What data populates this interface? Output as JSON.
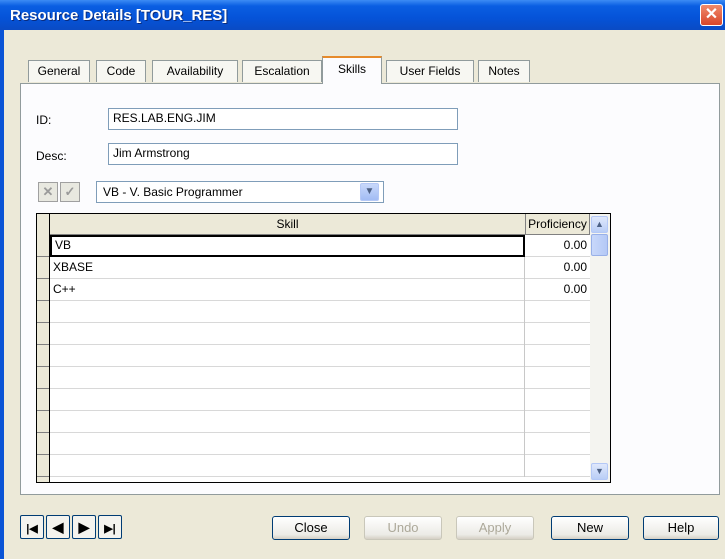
{
  "window": {
    "title": "Resource Details [TOUR_RES]",
    "close_glyph": "✕"
  },
  "tabs": [
    {
      "label": "General",
      "active": false
    },
    {
      "label": "Code",
      "active": false
    },
    {
      "label": "Availability",
      "active": false
    },
    {
      "label": "Escalation",
      "active": false
    },
    {
      "label": "Skills",
      "active": true
    },
    {
      "label": "User Fields",
      "active": false
    },
    {
      "label": "Notes",
      "active": false
    }
  ],
  "form": {
    "id_label": "ID:",
    "id_value": "RES.LAB.ENG.JIM",
    "desc_label": "Desc:",
    "desc_value": "Jim Armstrong"
  },
  "skill_toolbar": {
    "cancel_icon": "cross-icon",
    "cancel_glyph": "✕",
    "accept_icon": "checkmark-icon",
    "accept_glyph": "✓",
    "selected_skill": "VB - V. Basic Programmer",
    "dropdown_glyph": "▼"
  },
  "grid": {
    "columns": [
      "Skill",
      "Proficiency"
    ],
    "rows": [
      {
        "skill": "VB",
        "proficiency": "0.00"
      },
      {
        "skill": "XBASE",
        "proficiency": "0.00"
      },
      {
        "skill": "C++",
        "proficiency": "0.00"
      },
      {
        "skill": "",
        "proficiency": ""
      },
      {
        "skill": "",
        "proficiency": ""
      },
      {
        "skill": "",
        "proficiency": ""
      },
      {
        "skill": "",
        "proficiency": ""
      },
      {
        "skill": "",
        "proficiency": ""
      },
      {
        "skill": "",
        "proficiency": ""
      },
      {
        "skill": "",
        "proficiency": ""
      },
      {
        "skill": "",
        "proficiency": ""
      }
    ],
    "scroll_up_glyph": "▲",
    "scroll_down_glyph": "▼"
  },
  "navigation": {
    "first_glyph": "|◀",
    "prev_glyph": "◀",
    "next_glyph": "▶",
    "last_glyph": "▶|"
  },
  "buttons": {
    "close": "Close",
    "undo": "Undo",
    "apply": "Apply",
    "new": "New",
    "help": "Help"
  },
  "colors": {
    "titlebar": "#0553d8",
    "active_tab_accent": "#e68b2c"
  }
}
